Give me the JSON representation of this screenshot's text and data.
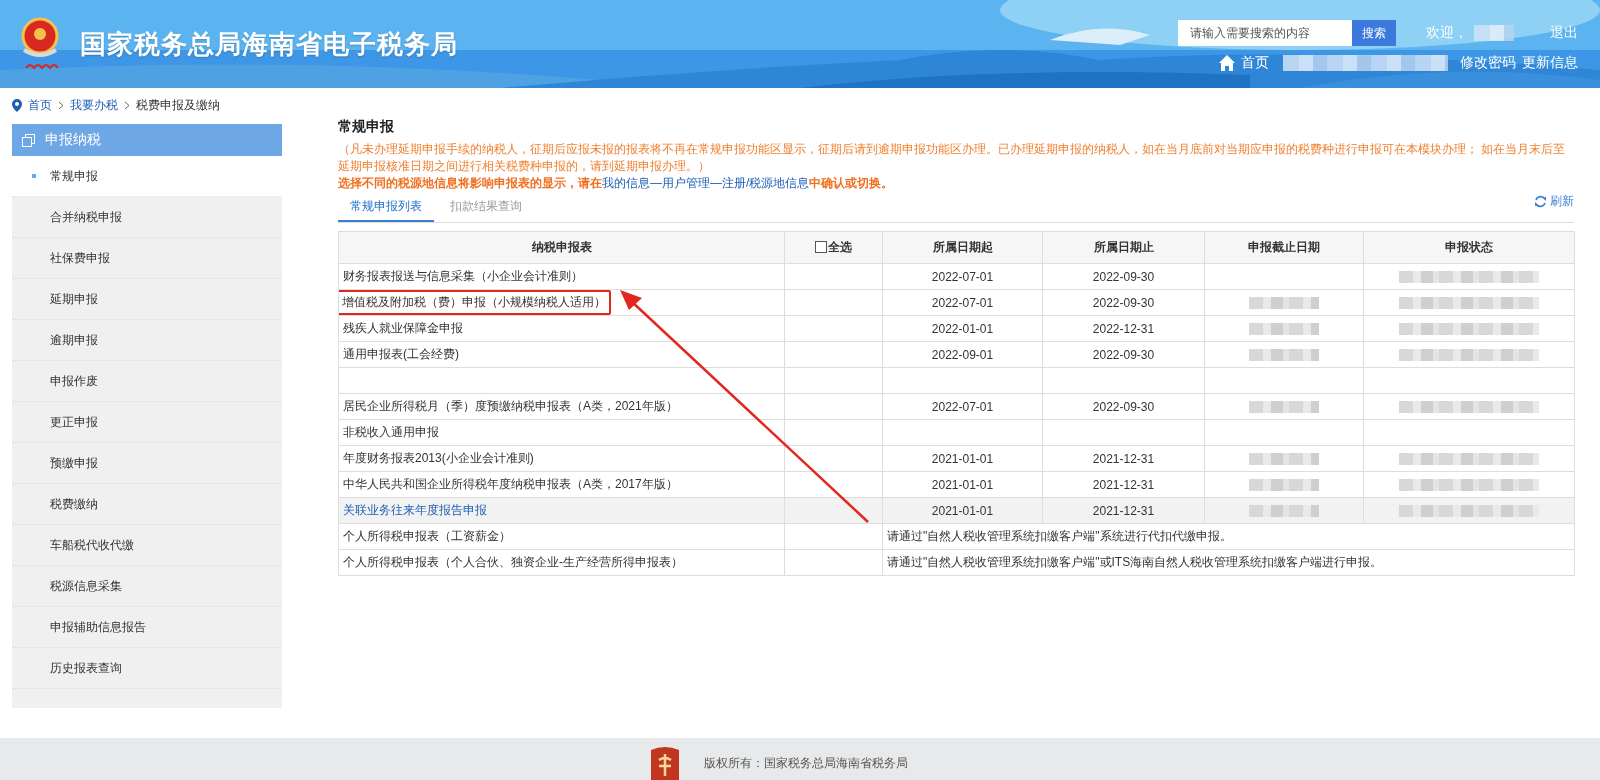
{
  "header": {
    "title": "国家税务总局海南省电子税务局",
    "search": {
      "placeholder": "请输入需要搜索的内容",
      "button": "搜索"
    },
    "welcome": "欢迎，",
    "user_name_blurred": true,
    "logout": "退出",
    "nav": [
      {
        "kind": "home",
        "label": "首页"
      },
      {
        "kind": "blurred"
      },
      {
        "kind": "link",
        "label": "修改密码"
      },
      {
        "kind": "link",
        "label": "更新信息"
      }
    ]
  },
  "breadcrumb": [
    "首页",
    "我要办税",
    "税费申报及缴纳"
  ],
  "sidebar": {
    "title": "申报纳税",
    "items": [
      {
        "label": "常规申报",
        "selected": true
      },
      {
        "label": "合并纳税申报",
        "selected": false
      },
      {
        "label": "社保费申报",
        "selected": false
      },
      {
        "label": "延期申报",
        "selected": false
      },
      {
        "label": "逾期申报",
        "selected": false
      },
      {
        "label": "申报作废",
        "selected": false
      },
      {
        "label": "更正申报",
        "selected": false
      },
      {
        "label": "预缴申报",
        "selected": false
      },
      {
        "label": "税费缴纳",
        "selected": false
      },
      {
        "label": "车船税代收代缴",
        "selected": false
      },
      {
        "label": "税源信息采集",
        "selected": false
      },
      {
        "label": "申报辅助信息报告",
        "selected": false
      },
      {
        "label": "历史报表查询",
        "selected": false
      }
    ]
  },
  "main": {
    "title": "常规申报",
    "notice": "（凡未办理延期申报手续的纳税人，征期后应报未报的报表将不再在常规申报功能区显示，征期后请到逾期申报功能区办理。已办理延期申报的纳税人，如在当月底前对当期应申报的税费种进行申报可在本模块办理；  如在当月末后至延期申报核准日期之间进行相关税费种申报的，请到延期申报办理。）",
    "warning": [
      {
        "kind": "bold",
        "text": "选择不同的税源地信息将影响申报表的显示，请在"
      },
      {
        "kind": "link",
        "text": "我的信息—用户管理—注册/税源地信息"
      },
      {
        "kind": "bold",
        "text": "中确认或切换。"
      }
    ],
    "tabs": [
      {
        "label": "常规申报列表",
        "selected": true
      },
      {
        "label": "扣款结果查询",
        "selected": false
      }
    ],
    "refresh": "刷新",
    "table": {
      "columns": [
        "纳税申报表",
        "全选",
        "所属日期起",
        "所属日期止",
        "申报截止日期",
        "申报状态"
      ],
      "select_all_checked": false,
      "rows": [
        {
          "kind": "form",
          "name": "财务报表报送与信息采集（小企业会计准则）",
          "start": "2022-07-01",
          "end": "2022-09-30",
          "deadline_blurred": false,
          "status_blurred": true,
          "highlighted": false
        },
        {
          "kind": "form",
          "name": "增值税及附加税（费）申报（小规模纳税人适用）",
          "start": "2022-07-01",
          "end": "2022-09-30",
          "deadline_blurred": true,
          "status_blurred": true,
          "highlighted": true
        },
        {
          "kind": "form",
          "name": "残疾人就业保障金申报",
          "start": "2022-01-01",
          "end": "2022-12-31",
          "deadline_blurred": true,
          "status_blurred": true,
          "highlighted": false
        },
        {
          "kind": "form",
          "name": "通用申报表(工会经费)",
          "start": "2022-09-01",
          "end": "2022-09-30",
          "deadline_blurred": true,
          "status_blurred": true,
          "highlighted": false
        },
        {
          "kind": "empty"
        },
        {
          "kind": "form",
          "name": "居民企业所得税月（季）度预缴纳税申报表（A类，2021年版）",
          "start": "2022-07-01",
          "end": "2022-09-30",
          "deadline_blurred": true,
          "status_blurred": true,
          "highlighted": false
        },
        {
          "kind": "form",
          "name": "非税收入通用申报",
          "deadline_blurred": false,
          "status_blurred": false,
          "highlighted": false
        },
        {
          "kind": "form",
          "name": "年度财务报表2013(小企业会计准则)",
          "start": "2021-01-01",
          "end": "2021-12-31",
          "deadline_blurred": true,
          "status_blurred": true,
          "highlighted": false
        },
        {
          "kind": "form",
          "name": "中华人民共和国企业所得税年度纳税申报表（A类，2017年版）",
          "start": "2021-01-01",
          "end": "2021-12-31",
          "deadline_blurred": true,
          "status_blurred": true,
          "highlighted": false
        },
        {
          "kind": "link",
          "name": "关联业务往来年度报告申报",
          "start": "2021-01-01",
          "end": "2021-12-31",
          "deadline_blurred": true,
          "status_blurred": true,
          "highlighted": false
        },
        {
          "kind": "note",
          "name": "个人所得税申报表（工资薪金）",
          "note": "请通过\"自然人税收管理系统扣缴客户端\"系统进行代扣代缴申报。"
        },
        {
          "kind": "note",
          "name": "个人所得税申报表（个人合伙、独资企业-生产经营所得申报表）",
          "note": "请通过\"自然人税收管理系统扣缴客户端\"或ITS海南自然人税收管理系统扣缴客户端进行申报。"
        }
      ]
    }
  },
  "footer": {
    "copyright": "版权所有：国家税务总局海南省税务局"
  }
}
